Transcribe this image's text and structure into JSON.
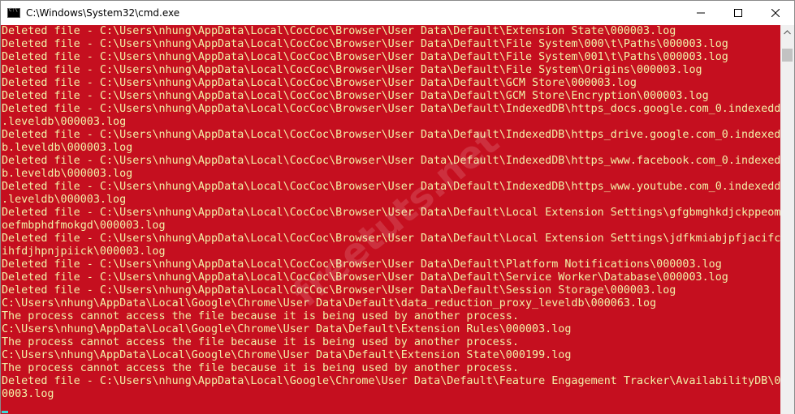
{
  "window": {
    "title": "C:\\Windows\\System32\\cmd.exe",
    "icon": "cmd-icon",
    "colors": {
      "background": "#c50f1f",
      "text": "#f2f2a8",
      "cursor": "#3ad5d5"
    }
  },
  "controls": {
    "minimize_icon": "minimize-icon",
    "maximize_icon": "maximize-icon",
    "close_icon": "close-icon"
  },
  "console": {
    "lines": [
      "Deleted file - C:\\Users\\nhung\\AppData\\Local\\CocCoc\\Browser\\User Data\\Default\\Extension State\\000003.log",
      "Deleted file - C:\\Users\\nhung\\AppData\\Local\\CocCoc\\Browser\\User Data\\Default\\File System\\000\\t\\Paths\\000003.log",
      "Deleted file - C:\\Users\\nhung\\AppData\\Local\\CocCoc\\Browser\\User Data\\Default\\File System\\001\\t\\Paths\\000003.log",
      "Deleted file - C:\\Users\\nhung\\AppData\\Local\\CocCoc\\Browser\\User Data\\Default\\File System\\Origins\\000003.log",
      "Deleted file - C:\\Users\\nhung\\AppData\\Local\\CocCoc\\Browser\\User Data\\Default\\GCM Store\\000003.log",
      "Deleted file - C:\\Users\\nhung\\AppData\\Local\\CocCoc\\Browser\\User Data\\Default\\GCM Store\\Encryption\\000003.log",
      "Deleted file - C:\\Users\\nhung\\AppData\\Local\\CocCoc\\Browser\\User Data\\Default\\IndexedDB\\https_docs.google.com_0.indexeddb",
      ".leveldb\\000003.log",
      "Deleted file - C:\\Users\\nhung\\AppData\\Local\\CocCoc\\Browser\\User Data\\Default\\IndexedDB\\https_drive.google.com_0.indexedd",
      "b.leveldb\\000003.log",
      "Deleted file - C:\\Users\\nhung\\AppData\\Local\\CocCoc\\Browser\\User Data\\Default\\IndexedDB\\https_www.facebook.com_0.indexedd",
      "b.leveldb\\000003.log",
      "Deleted file - C:\\Users\\nhung\\AppData\\Local\\CocCoc\\Browser\\User Data\\Default\\IndexedDB\\https_www.youtube.com_0.indexeddb",
      ".leveldb\\000003.log",
      "Deleted file - C:\\Users\\nhung\\AppData\\Local\\CocCoc\\Browser\\User Data\\Default\\Local Extension Settings\\gfgbmghkdjckppeoml",
      "oefmbphdfmokgd\\000003.log",
      "Deleted file - C:\\Users\\nhung\\AppData\\Local\\CocCoc\\Browser\\User Data\\Default\\Local Extension Settings\\jdfkmiabjpfjacifcm",
      "ihfdjhpnjpiick\\000003.log",
      "Deleted file - C:\\Users\\nhung\\AppData\\Local\\CocCoc\\Browser\\User Data\\Default\\Platform Notifications\\000003.log",
      "Deleted file - C:\\Users\\nhung\\AppData\\Local\\CocCoc\\Browser\\User Data\\Default\\Service Worker\\Database\\000003.log",
      "Deleted file - C:\\Users\\nhung\\AppData\\Local\\CocCoc\\Browser\\User Data\\Default\\Session Storage\\000003.log",
      "C:\\Users\\nhung\\AppData\\Local\\Google\\Chrome\\User Data\\Default\\data_reduction_proxy_leveldb\\000063.log",
      "The process cannot access the file because it is being used by another process.",
      "C:\\Users\\nhung\\AppData\\Local\\Google\\Chrome\\User Data\\Default\\Extension Rules\\000003.log",
      "The process cannot access the file because it is being used by another process.",
      "C:\\Users\\nhung\\AppData\\Local\\Google\\Chrome\\User Data\\Default\\Extension State\\000199.log",
      "The process cannot access the file because it is being used by another process.",
      "Deleted file - C:\\Users\\nhung\\AppData\\Local\\Google\\Chrome\\User Data\\Default\\Feature Engagement Tracker\\AvailabilityDB\\00",
      "0003.log"
    ]
  },
  "scrollbar": {
    "up_icon": "scroll-up-icon",
    "down_icon": "scroll-down-icon"
  },
  "watermark": {
    "text": "freetuts.net"
  }
}
